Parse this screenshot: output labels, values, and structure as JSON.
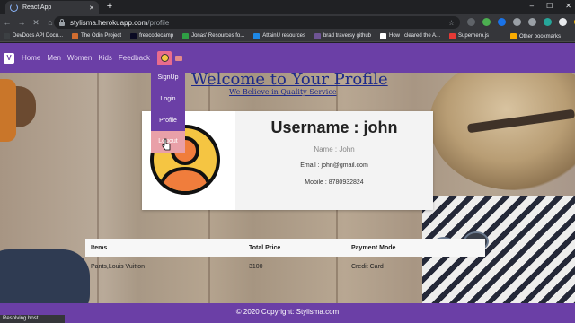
{
  "browser": {
    "tab_title": "React App",
    "tab_close": "✕",
    "new_tab": "+",
    "window_controls": [
      "–",
      "☐",
      "✕"
    ],
    "nav": {
      "back": "←",
      "forward": "→",
      "reload": "✕",
      "home": "⌂"
    },
    "url_host": "stylisma.herokuapp.com",
    "url_path": "/profile",
    "star": "☆",
    "extension_colors": [
      "#5f6368",
      "#4caf50",
      "#1a73e8",
      "#9aa0a6",
      "#9aa0a6",
      "#26a69a",
      "#e8eaed",
      "#f4b400"
    ],
    "bookmarks": [
      {
        "label": "DevDocs API Docu...",
        "color": "#3c4043"
      },
      {
        "label": "The Odin Project",
        "color": "#d16d30"
      },
      {
        "label": "freecodecamp",
        "color": "#0a0a23"
      },
      {
        "label": "Jonas' Resources fo...",
        "color": "#2f9e44"
      },
      {
        "label": "AttainU resources",
        "color": "#1e88e5"
      },
      {
        "label": "brad traversy github",
        "color": "#6e5494"
      },
      {
        "label": "How I cleared the A...",
        "color": "#ffffff"
      },
      {
        "label": "Superhero.js",
        "color": "#e53935"
      }
    ],
    "other_bookmarks": "Other bookmarks",
    "status_text": "Resolving host..."
  },
  "navbar": {
    "brand_mark": "V",
    "links": [
      "Home",
      "Men",
      "Women",
      "Kids",
      "Feedback"
    ]
  },
  "dropdown": {
    "items": [
      "SignUp",
      "Login",
      "Profile",
      "Logout"
    ]
  },
  "hero": {
    "title": "Welcome to Your Profile",
    "tagline": "We Believe in Quality Service"
  },
  "profile": {
    "username_line": "Username : john",
    "name_line": "Name : John",
    "email_line": "Email : john@gmail.com",
    "mobile_line": "Mobile : 8780932824"
  },
  "orders": {
    "headers": [
      "Items",
      "Total Price",
      "Payment Mode"
    ],
    "rows": [
      [
        "Pants,Louis Vuitton",
        "3100",
        "Credit Card"
      ]
    ]
  },
  "footer": {
    "text": "© 2020 Copyright: Stylisma.com"
  }
}
